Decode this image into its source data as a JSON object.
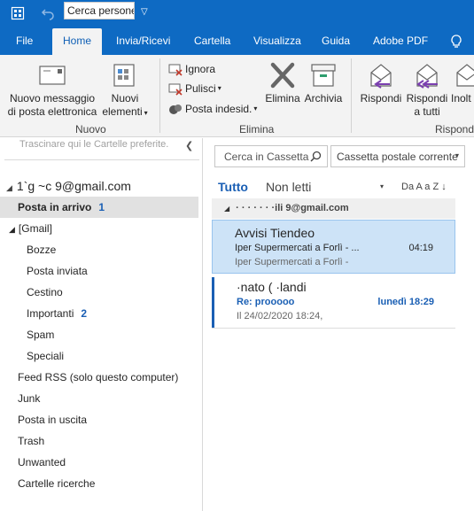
{
  "quick_access": {
    "search_placeholder": "Cerca persone",
    "dropdown_glyph": "▽"
  },
  "tabs": [
    {
      "label": "File"
    },
    {
      "label": "Home"
    },
    {
      "label": "Invia/Ricevi"
    },
    {
      "label": "Cartella"
    },
    {
      "label": "Visualizza"
    },
    {
      "label": "Guida"
    },
    {
      "label": "Adobe PDF"
    }
  ],
  "ribbon": {
    "new_email": "Nuovo messaggio\ndi posta elettronica",
    "new_items": "Nuovi\nelementi",
    "ignore": "Ignora",
    "cleanup": "Pulisci",
    "junk": "Posta indesid.",
    "delete": "Elimina",
    "archive": "Archivia",
    "reply": "Rispondi",
    "reply_all": "Rispondi\na tutti",
    "forward": "Inolt",
    "group_new": "Nuovo",
    "group_delete": "Elimina",
    "group_respond": "Rispond"
  },
  "folder_pane": {
    "favorites_hint": "Trascinare qui le Cartelle preferite.",
    "account": "1`g   ~c 9@gmail.com",
    "folders": [
      {
        "label": "Posta in arrivo",
        "count": "1"
      },
      {
        "label": "[Gmail]",
        "count": ""
      },
      {
        "label": "Bozze",
        "count": ""
      },
      {
        "label": "Posta inviata",
        "count": ""
      },
      {
        "label": "Cestino",
        "count": ""
      },
      {
        "label": "Importanti",
        "count": "2"
      },
      {
        "label": "Spam",
        "count": ""
      },
      {
        "label": "Speciali",
        "count": ""
      },
      {
        "label": "Feed RSS (solo questo computer)",
        "count": ""
      },
      {
        "label": "Junk",
        "count": ""
      },
      {
        "label": "Posta in uscita",
        "count": ""
      },
      {
        "label": "Trash",
        "count": ""
      },
      {
        "label": "Unwanted",
        "count": ""
      },
      {
        "label": "Cartelle ricerche",
        "count": ""
      }
    ]
  },
  "message_list": {
    "search_placeholder": "Cerca in Cassetta",
    "scope": "Cassetta postale corrente",
    "filter_all": "Tutto",
    "filter_unread": "Non letti",
    "sort_label": "Da A a Z",
    "group_header": "·    ·  ·  ·  ·  ·  ·ili  9@gmail.com",
    "messages": [
      {
        "from": "Avvisi Tiendeo",
        "subject": "Iper Supermercati a Forlì - ...",
        "preview": "Iper Supermercati a Forlì -",
        "time": "04:19"
      },
      {
        "from": "   ·nato  ( ·landi",
        "subject": "Re: prooooo",
        "preview": "Il 24/02/2020 18:24,",
        "time": "lunedì 18:29"
      }
    ]
  },
  "colors": {
    "brand": "#0e6ac3",
    "accent": "#1a5fb4",
    "selection": "#cde3f7"
  }
}
